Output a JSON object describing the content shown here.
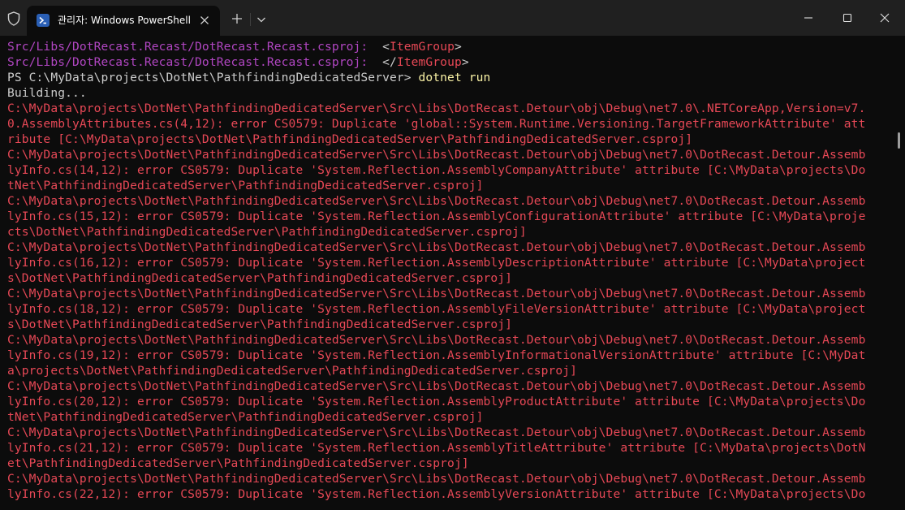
{
  "tab": {
    "title": "관리자: Windows PowerShell"
  },
  "icons": {
    "shield": "shield-icon",
    "powershell": "powershell-icon",
    "close_tab": "close-icon",
    "new_tab": "plus-icon",
    "dropdown": "chevron-down-icon",
    "minimize": "minimize-icon",
    "maximize": "maximize-icon",
    "close_window": "close-icon"
  },
  "colors": {
    "background": "#0c0c0c",
    "titlebar": "#202020",
    "text": "#cccccc",
    "error": "#e74856",
    "path": "#b146c2",
    "command": "#f9f1a5"
  },
  "terminal": {
    "lines": [
      {
        "path": "Src/Libs/DotRecast.Recast/DotRecast.Recast.csproj:",
        "pre": "  <",
        "tag": "ItemGroup",
        "post": ">"
      },
      {
        "path": "Src/Libs/DotRecast.Recast/DotRecast.Recast.csproj:",
        "pre": "  </",
        "tag": "ItemGroup",
        "post": ">"
      },
      {
        "prompt": "PS C:\\MyData\\projects\\DotNet\\PathfindingDedicatedServer> ",
        "command": "dotnet run"
      },
      {
        "text": "Building..."
      },
      {
        "error": "C:\\MyData\\projects\\DotNet\\PathfindingDedicatedServer\\Src\\Libs\\DotRecast.Detour\\obj\\Debug\\net7.0\\.NETCoreApp,Version=v7."
      },
      {
        "error": "0.AssemblyAttributes.cs(4,12): error CS0579: Duplicate 'global::System.Runtime.Versioning.TargetFrameworkAttribute' att"
      },
      {
        "error": "ribute [C:\\MyData\\projects\\DotNet\\PathfindingDedicatedServer\\PathfindingDedicatedServer.csproj]"
      },
      {
        "error": "C:\\MyData\\projects\\DotNet\\PathfindingDedicatedServer\\Src\\Libs\\DotRecast.Detour\\obj\\Debug\\net7.0\\DotRecast.Detour.Assemb"
      },
      {
        "error": "lyInfo.cs(14,12): error CS0579: Duplicate 'System.Reflection.AssemblyCompanyAttribute' attribute [C:\\MyData\\projects\\Do"
      },
      {
        "error": "tNet\\PathfindingDedicatedServer\\PathfindingDedicatedServer.csproj]"
      },
      {
        "error": "C:\\MyData\\projects\\DotNet\\PathfindingDedicatedServer\\Src\\Libs\\DotRecast.Detour\\obj\\Debug\\net7.0\\DotRecast.Detour.Assemb"
      },
      {
        "error": "lyInfo.cs(15,12): error CS0579: Duplicate 'System.Reflection.AssemblyConfigurationAttribute' attribute [C:\\MyData\\proje"
      },
      {
        "error": "cts\\DotNet\\PathfindingDedicatedServer\\PathfindingDedicatedServer.csproj]"
      },
      {
        "error": "C:\\MyData\\projects\\DotNet\\PathfindingDedicatedServer\\Src\\Libs\\DotRecast.Detour\\obj\\Debug\\net7.0\\DotRecast.Detour.Assemb"
      },
      {
        "error": "lyInfo.cs(16,12): error CS0579: Duplicate 'System.Reflection.AssemblyDescriptionAttribute' attribute [C:\\MyData\\project"
      },
      {
        "error": "s\\DotNet\\PathfindingDedicatedServer\\PathfindingDedicatedServer.csproj]"
      },
      {
        "error": "C:\\MyData\\projects\\DotNet\\PathfindingDedicatedServer\\Src\\Libs\\DotRecast.Detour\\obj\\Debug\\net7.0\\DotRecast.Detour.Assemb"
      },
      {
        "error": "lyInfo.cs(18,12): error CS0579: Duplicate 'System.Reflection.AssemblyFileVersionAttribute' attribute [C:\\MyData\\project"
      },
      {
        "error": "s\\DotNet\\PathfindingDedicatedServer\\PathfindingDedicatedServer.csproj]"
      },
      {
        "error": "C:\\MyData\\projects\\DotNet\\PathfindingDedicatedServer\\Src\\Libs\\DotRecast.Detour\\obj\\Debug\\net7.0\\DotRecast.Detour.Assemb"
      },
      {
        "error": "lyInfo.cs(19,12): error CS0579: Duplicate 'System.Reflection.AssemblyInformationalVersionAttribute' attribute [C:\\MyDat"
      },
      {
        "error": "a\\projects\\DotNet\\PathfindingDedicatedServer\\PathfindingDedicatedServer.csproj]"
      },
      {
        "error": "C:\\MyData\\projects\\DotNet\\PathfindingDedicatedServer\\Src\\Libs\\DotRecast.Detour\\obj\\Debug\\net7.0\\DotRecast.Detour.Assemb"
      },
      {
        "error": "lyInfo.cs(20,12): error CS0579: Duplicate 'System.Reflection.AssemblyProductAttribute' attribute [C:\\MyData\\projects\\Do"
      },
      {
        "error": "tNet\\PathfindingDedicatedServer\\PathfindingDedicatedServer.csproj]"
      },
      {
        "error": "C:\\MyData\\projects\\DotNet\\PathfindingDedicatedServer\\Src\\Libs\\DotRecast.Detour\\obj\\Debug\\net7.0\\DotRecast.Detour.Assemb"
      },
      {
        "error": "lyInfo.cs(21,12): error CS0579: Duplicate 'System.Reflection.AssemblyTitleAttribute' attribute [C:\\MyData\\projects\\DotN"
      },
      {
        "error": "et\\PathfindingDedicatedServer\\PathfindingDedicatedServer.csproj]"
      },
      {
        "error": "C:\\MyData\\projects\\DotNet\\PathfindingDedicatedServer\\Src\\Libs\\DotRecast.Detour\\obj\\Debug\\net7.0\\DotRecast.Detour.Assemb"
      },
      {
        "error": "lyInfo.cs(22,12): error CS0579: Duplicate 'System.Reflection.AssemblyVersionAttribute' attribute [C:\\MyData\\projects\\Do"
      }
    ]
  }
}
